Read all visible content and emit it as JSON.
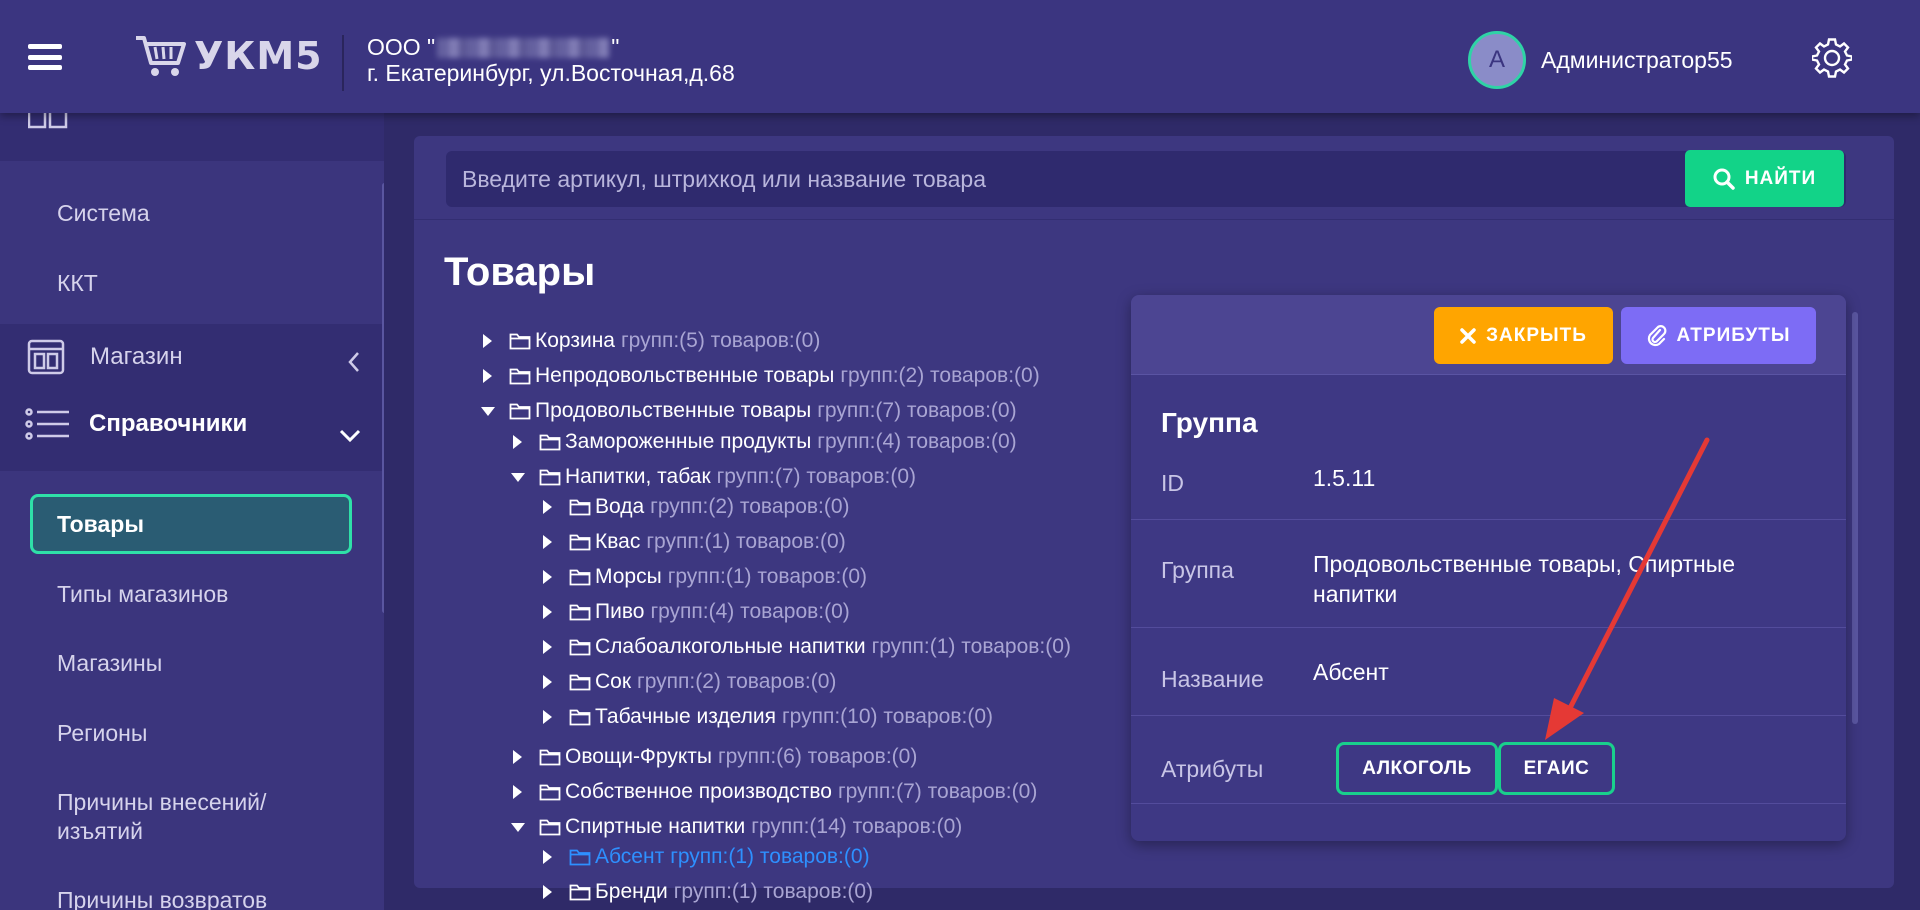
{
  "header": {
    "logo_text": "УКМ5",
    "org_prefix": "ООО \"",
    "org_suffix": "\"",
    "org_address": "г. Екатеринбург, ул.Восточная,д.68",
    "avatar_letter": "А",
    "user_name": "Администратор55"
  },
  "sidebar": {
    "items_top": [
      "Система",
      "ККТ"
    ],
    "sections": [
      {
        "label": "Магазин",
        "expanded": false
      },
      {
        "label": "Справочники",
        "expanded": true
      }
    ],
    "active_item": "Товары",
    "items": [
      "Типы магазинов",
      "Магазины",
      "Регионы",
      "Причины внесений/",
      "изъятий",
      "Причины возвратов"
    ]
  },
  "search": {
    "placeholder": "Введите артикул, штрихкод или название товара",
    "button_label": "НАЙТИ"
  },
  "page": {
    "title": "Товары"
  },
  "tree": [
    {
      "level": 0,
      "expanded": false,
      "name": "Корзина",
      "meta": "групп:(5) товаров:(0)"
    },
    {
      "level": 0,
      "expanded": false,
      "name": "Непродовольственные товары",
      "meta": "групп:(2) товаров:(0)"
    },
    {
      "level": 0,
      "expanded": true,
      "name": "Продовольственные товары",
      "meta": "групп:(7) товаров:(0)"
    },
    {
      "level": 1,
      "expanded": false,
      "name": "Замороженные продукты",
      "meta": "групп:(4) товаров:(0)"
    },
    {
      "level": 1,
      "expanded": true,
      "name": "Напитки, табак",
      "meta": "групп:(7) товаров:(0)"
    },
    {
      "level": 2,
      "expanded": false,
      "name": "Вода",
      "meta": "групп:(2) товаров:(0)"
    },
    {
      "level": 2,
      "expanded": false,
      "name": "Квас",
      "meta": "групп:(1) товаров:(0)"
    },
    {
      "level": 2,
      "expanded": false,
      "name": "Морсы",
      "meta": "групп:(1) товаров:(0)"
    },
    {
      "level": 2,
      "expanded": false,
      "name": "Пиво",
      "meta": "групп:(4) товаров:(0)"
    },
    {
      "level": 2,
      "expanded": false,
      "name": "Слабоалкогольные напитки",
      "meta": "групп:(1) товаров:(0)"
    },
    {
      "level": 2,
      "expanded": false,
      "name": "Сок",
      "meta": "групп:(2) товаров:(0)"
    },
    {
      "level": 2,
      "expanded": false,
      "name": "Табачные изделия",
      "meta": "групп:(10) товаров:(0)"
    },
    {
      "level": 1,
      "expanded": false,
      "name": "Овощи-Фрукты",
      "meta": "групп:(6) товаров:(0)"
    },
    {
      "level": 1,
      "expanded": false,
      "name": "Собственное производство",
      "meta": "групп:(7) товаров:(0)"
    },
    {
      "level": 1,
      "expanded": true,
      "name": "Спиртные напитки",
      "meta": "групп:(14) товаров:(0)"
    },
    {
      "level": 2,
      "expanded": false,
      "selected": true,
      "name": "Абсент",
      "meta": "групп:(1) товаров:(0)"
    },
    {
      "level": 2,
      "expanded": false,
      "name": "Бренди",
      "meta": "групп:(1) товаров:(0)"
    }
  ],
  "card": {
    "close_label": "ЗАКРЫТЬ",
    "attributes_label": "АТРИБУТЫ",
    "title": "Группа",
    "fields": [
      {
        "label": "ID",
        "value": "1.5.11"
      },
      {
        "label": "Группа",
        "value": "Продовольственные товары, Спиртные напитки"
      },
      {
        "label": "Название",
        "value": "Абсент"
      },
      {
        "label": "Атрибуты",
        "value": ""
      }
    ],
    "chips": [
      "АЛКОГОЛЬ",
      "ЕГАИС"
    ]
  },
  "colors": {
    "accent_green": "#12d388",
    "close_orange": "#ffa500",
    "attr_purple": "#7d6cf5",
    "annotation_arrow": "#e53935"
  }
}
